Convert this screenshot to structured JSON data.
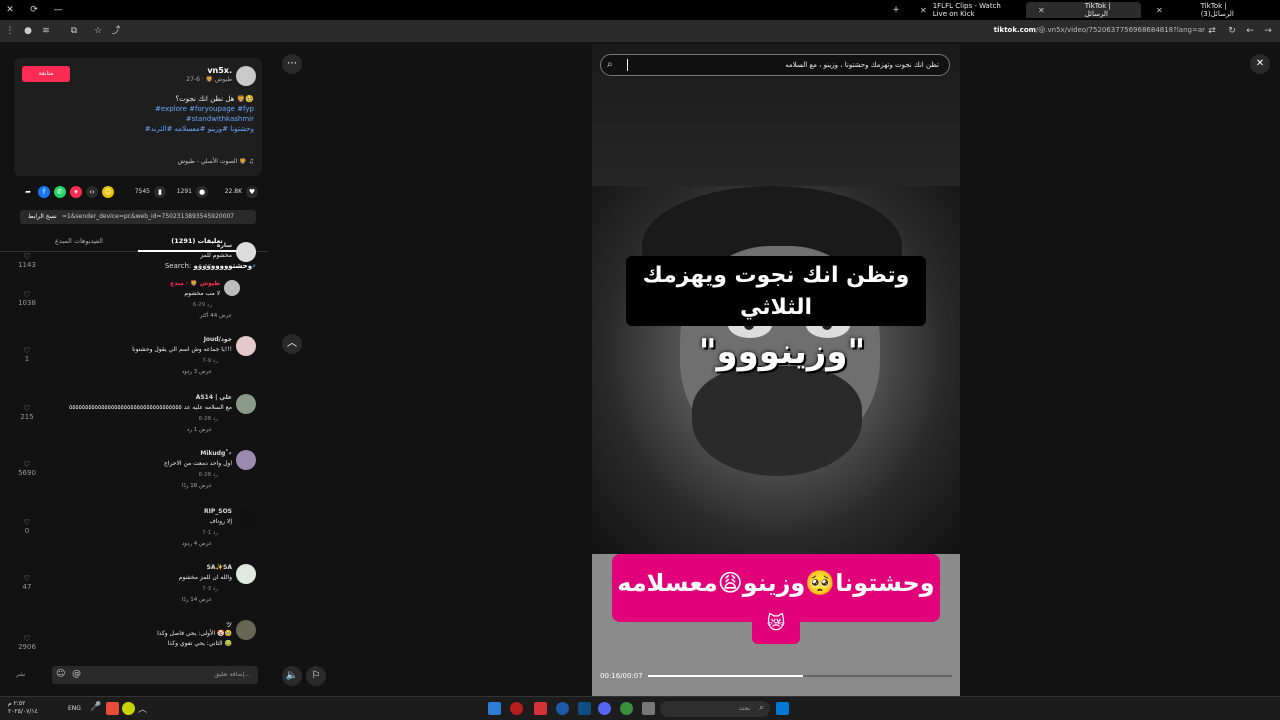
{
  "browser": {
    "tabs": [
      {
        "label": "1FLFL Clips - Watch Live on Kick"
      },
      {
        "label": "TikTok | الرسائل"
      },
      {
        "label": "TikTok | (3)الرسائل"
      }
    ],
    "url_domain": "tiktok.com",
    "url_rest": "/@.vn5x/video/7520637756968684818?lang=ar"
  },
  "post": {
    "username": "vn5x.",
    "display_meta": "طيوش 🦁 · 6-27",
    "follow_label": "متابعة",
    "caption": "هل تظن انك نجوت؟ 🦁🥹",
    "hashtags_line1": "#explore #foryoupage #fyp",
    "hashtags_line2": "#standwithkashmir",
    "hashtags_line3": "#وحشتونا #وزينو #معسلامه #الترند",
    "sound": "الصوت الأصلي - طيوش 🦁",
    "likes": "22.8K",
    "comments": "1291",
    "saves": "7545",
    "link_value": "=1&sender_device=pc&web_id=7502313893545920007",
    "copy_link_label": "نسخ الرابط"
  },
  "tabs": {
    "comments_label": "تعليقات (1291)",
    "creator_videos_label": "الفيديوهات المبدع"
  },
  "search_line": {
    "prefix": "Search:",
    "term": "وحشتووووووووو"
  },
  "comments": [
    {
      "name": "ساره",
      "text": "مخشوم للمز",
      "meta": "6-27   رد",
      "likes": "1143",
      "more": ""
    },
    {
      "name": "طيوش 🦁 · مبدع",
      "text": "لا مب مخشوم",
      "meta": "6-29   رد",
      "likes": "1038",
      "more": "عرض 44 أكثر"
    },
    {
      "name": "Joud/جود",
      "text": "يا جماعه وش اسم الي يقول وحشتونا!!!",
      "meta": "7-9   رد",
      "likes": "1",
      "more": "عرض 3 ردود"
    },
    {
      "name": "AS14 | علي",
      "text": "مع السلامه عليه عد ٥٥٥٥٥٥٥٥٥٥٥٥٥٥٥٥٥٥٥٥٥٥٥٥٥٥٥٥٥٥٥٥٥٥٥",
      "meta": "6-28   رد",
      "likes": "215",
      "more": "عرض 1 رد"
    },
    {
      "name": "Mikudg˚⋆",
      "text": "اول واحد دمعت من الاحراج",
      "meta": "6-28   رد",
      "likes": "5690",
      "more": "عرض 18 ردًا"
    },
    {
      "name": "RIP_SOS",
      "text": "إلا روناف",
      "meta": "7-1   رد",
      "likes": "0",
      "more": "عرض 4 ردود"
    },
    {
      "name": "SA✨SA",
      "text": "والله ان للمز مخشوم",
      "meta": "7-3   رد",
      "likes": "47",
      "more": "عرض 14 ردًا"
    },
    {
      "name": "ツ",
      "text": "الأولى: يحي فاصل وكذا 🤡🥹",
      "text2": "الثاني: يحي تفوي وكذا 🤢",
      "meta": "",
      "likes": "2906",
      "more": ""
    }
  ],
  "input": {
    "placeholder": "إضافة تعليق...",
    "post_label": "نشر"
  },
  "player": {
    "search_text": "تظن انك نجوت وتهزمك وحشتونا ، وزينو ، مع السلامه",
    "caption_line1": "وتظن انك نجوت ويهزمك",
    "caption_line2": "الثلاثي",
    "quote": "\"وزينووو\"",
    "pink_caption": "وحشتونا🥺وزينو😩معسلامه",
    "pink_emoji": "😿",
    "timecode": "00:16/00:07",
    "progress": 0.51
  },
  "taskbar": {
    "search_placeholder": "بحث",
    "lang": "ENG",
    "time": "٢:٥٢ م",
    "date": "٢٠٢٥/٠٧/١٤"
  },
  "colors": {
    "accent": "#fe2c55",
    "hashtag": "#68a6ff",
    "pink": "#e2007a"
  }
}
